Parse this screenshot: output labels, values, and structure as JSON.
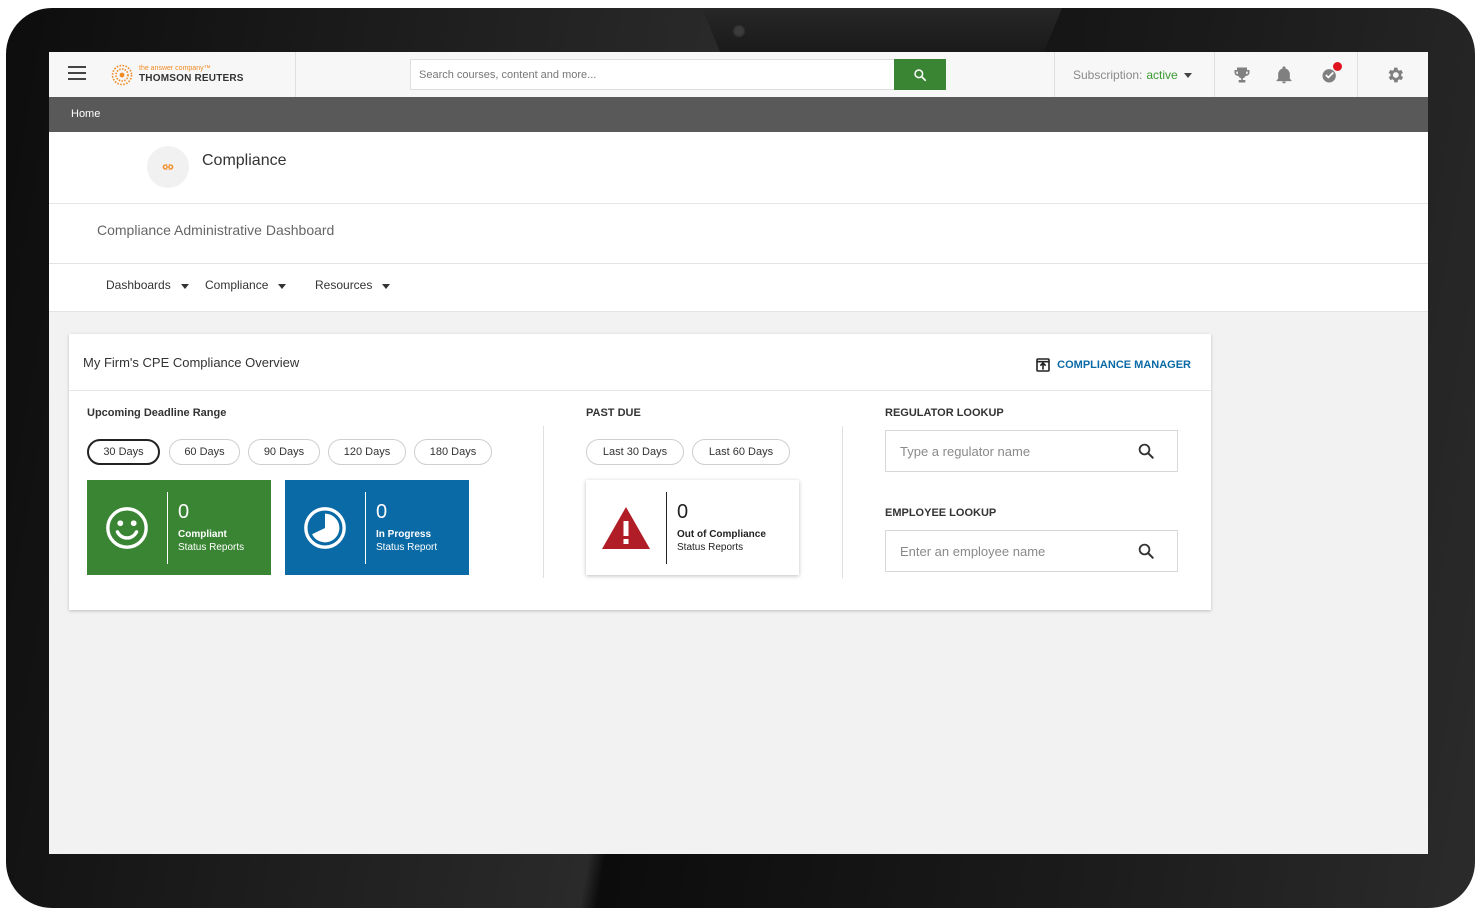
{
  "app": {
    "logo_tagline": "the answer company™",
    "logo_name": "THOMSON REUTERS",
    "search_placeholder": "Search courses, content and more...",
    "subscription_label": "Subscription:",
    "subscription_status": "active",
    "colors": {
      "brand_green": "#3a8533",
      "brand_blue": "#0a6aa6",
      "alert_red": "#b01d26",
      "logo_orange": "#f08a24"
    }
  },
  "breadcrumb": {
    "home": "Home"
  },
  "header": {
    "title": "Compliance",
    "subtitle": "Compliance Administrative Dashboard"
  },
  "nav": {
    "items": [
      {
        "label": "Dashboards"
      },
      {
        "label": "Compliance"
      },
      {
        "label": "Resources"
      }
    ]
  },
  "card": {
    "title": "My Firm's CPE Compliance Overview",
    "manager_link": "COMPLIANCE MANAGER",
    "upcoming": {
      "label": "Upcoming Deadline Range",
      "ranges": [
        "30 Days",
        "60 Days",
        "90 Days",
        "120 Days",
        "180 Days"
      ],
      "selected": "30 Days",
      "compliant": {
        "count": "0",
        "line1": "Compliant",
        "line2": "Status Reports"
      },
      "in_progress": {
        "count": "0",
        "line1": "In Progress",
        "line2": "Status Report"
      }
    },
    "past_due": {
      "label": "PAST DUE",
      "ranges": [
        "Last 30 Days",
        "Last 60 Days"
      ],
      "out_of_compliance": {
        "count": "0",
        "line1": "Out of Compliance",
        "line2": "Status Reports"
      }
    },
    "regulator_lookup": {
      "label": "REGULATOR LOOKUP",
      "placeholder": "Type a regulator name"
    },
    "employee_lookup": {
      "label": "EMPLOYEE LOOKUP",
      "placeholder": "Enter an employee name"
    }
  }
}
